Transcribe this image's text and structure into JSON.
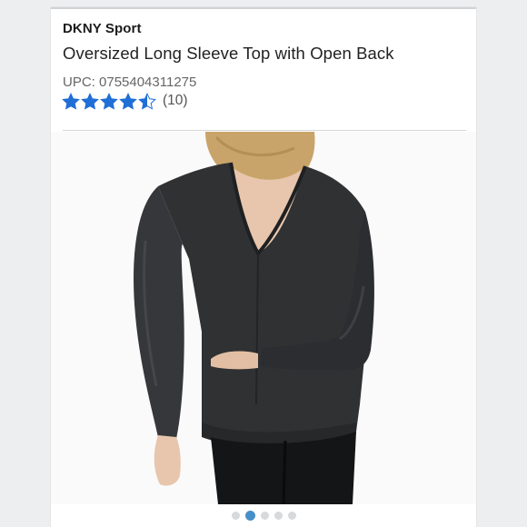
{
  "product": {
    "brand": "DKNY Sport",
    "title": "Oversized Long Sleeve Top with Open Back",
    "upc": "UPC: 0755404311275",
    "rating": {
      "stars": 4.5,
      "max": 5,
      "count_label": "(10)"
    }
  },
  "carousel": {
    "total": 5,
    "active_index": 1
  },
  "colors": {
    "star": "#1f6fd6",
    "dot_active": "#4690c7",
    "dot": "#d7d9db"
  }
}
